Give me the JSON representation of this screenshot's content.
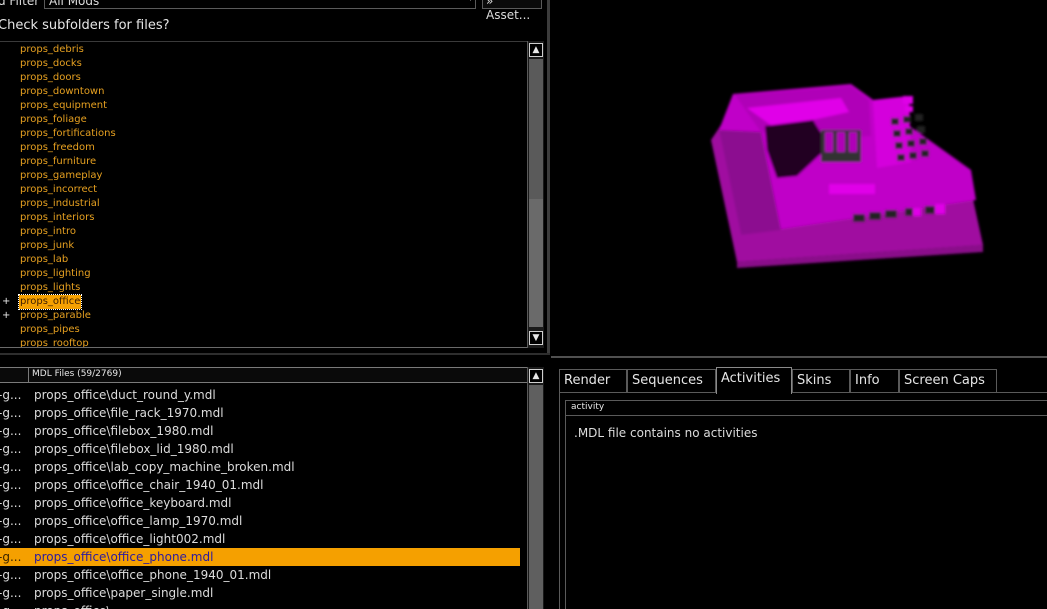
{
  "filter": {
    "label": "d Filter",
    "selected_value": "All Mods",
    "asset_button_label": "» Asset..."
  },
  "subfolders_label": "Check subfolders for files?",
  "tree": {
    "items": [
      {
        "label": "props_debris",
        "expandable": false,
        "selected": false
      },
      {
        "label": "props_docks",
        "expandable": false,
        "selected": false
      },
      {
        "label": "props_doors",
        "expandable": false,
        "selected": false
      },
      {
        "label": "props_downtown",
        "expandable": false,
        "selected": false
      },
      {
        "label": "props_equipment",
        "expandable": false,
        "selected": false
      },
      {
        "label": "props_foliage",
        "expandable": false,
        "selected": false
      },
      {
        "label": "props_fortifications",
        "expandable": false,
        "selected": false
      },
      {
        "label": "props_freedom",
        "expandable": false,
        "selected": false
      },
      {
        "label": "props_furniture",
        "expandable": false,
        "selected": false
      },
      {
        "label": "props_gameplay",
        "expandable": false,
        "selected": false
      },
      {
        "label": "props_incorrect",
        "expandable": false,
        "selected": false
      },
      {
        "label": "props_industrial",
        "expandable": false,
        "selected": false
      },
      {
        "label": "props_interiors",
        "expandable": false,
        "selected": false
      },
      {
        "label": "props_intro",
        "expandable": false,
        "selected": false
      },
      {
        "label": "props_junk",
        "expandable": false,
        "selected": false
      },
      {
        "label": "props_lab",
        "expandable": false,
        "selected": false
      },
      {
        "label": "props_lighting",
        "expandable": false,
        "selected": false
      },
      {
        "label": "props_lights",
        "expandable": false,
        "selected": false
      },
      {
        "label": "props_office",
        "expandable": true,
        "selected": true
      },
      {
        "label": "props_parable",
        "expandable": true,
        "selected": false
      },
      {
        "label": "props_pipes",
        "expandable": false,
        "selected": false
      },
      {
        "label": "props_rooftop",
        "expandable": false,
        "selected": false
      }
    ],
    "expand_glyph": "+"
  },
  "mdl_list": {
    "header": "MDL Files (59/2769)",
    "rows": [
      {
        "col1": "-g...",
        "file": "props_office\\duct_round_y.mdl",
        "selected": false
      },
      {
        "col1": "-g...",
        "file": "props_office\\file_rack_1970.mdl",
        "selected": false
      },
      {
        "col1": "-g...",
        "file": "props_office\\filebox_1980.mdl",
        "selected": false
      },
      {
        "col1": "-g...",
        "file": "props_office\\filebox_lid_1980.mdl",
        "selected": false
      },
      {
        "col1": "-g...",
        "file": "props_office\\lab_copy_machine_broken.mdl",
        "selected": false
      },
      {
        "col1": "-g...",
        "file": "props_office\\office_chair_1940_01.mdl",
        "selected": false
      },
      {
        "col1": "-g...",
        "file": "props_office\\office_keyboard.mdl",
        "selected": false
      },
      {
        "col1": "-g...",
        "file": "props_office\\office_lamp_1970.mdl",
        "selected": false
      },
      {
        "col1": "-g...",
        "file": "props_office\\office_light002.mdl",
        "selected": false
      },
      {
        "col1": "-g...",
        "file": "props_office\\office_phone.mdl",
        "selected": true
      },
      {
        "col1": "-g...",
        "file": "props_office\\office_phone_1940_01.mdl",
        "selected": false
      },
      {
        "col1": "-g...",
        "file": "props_office\\paper_single.mdl",
        "selected": false
      },
      {
        "col1": "-g...",
        "file": "props_office\\...",
        "selected": false
      }
    ]
  },
  "tabs": [
    {
      "label": "Render",
      "active": false
    },
    {
      "label": "Sequences",
      "active": false
    },
    {
      "label": "Activities",
      "active": true
    },
    {
      "label": "Skins",
      "active": false
    },
    {
      "label": "Info",
      "active": false
    },
    {
      "label": "Screen Caps",
      "active": false
    }
  ],
  "activity": {
    "header": "activity",
    "message": ".MDL file contains no activities"
  },
  "colors": {
    "background": "#000000",
    "selection": "#f5a000",
    "tree_text": "#e6a020",
    "model_color": "#c000c0"
  }
}
